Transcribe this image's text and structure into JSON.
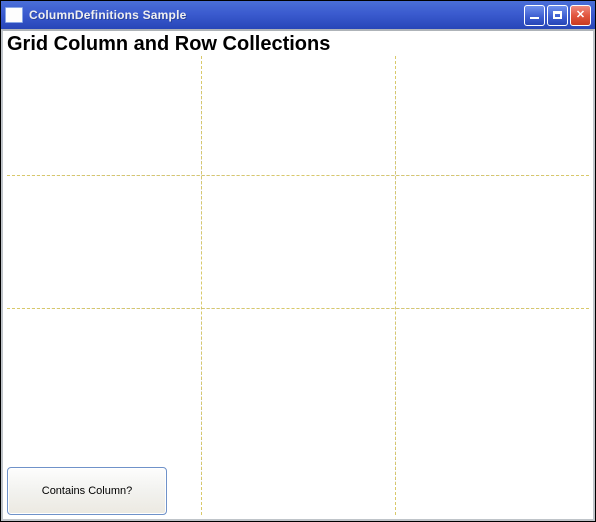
{
  "window": {
    "title": "ColumnDefinitions Sample"
  },
  "heading": "Grid Column and Row Collections",
  "grid": {
    "columns": 3,
    "rows": 3
  },
  "button": {
    "label": "Contains Column?"
  }
}
